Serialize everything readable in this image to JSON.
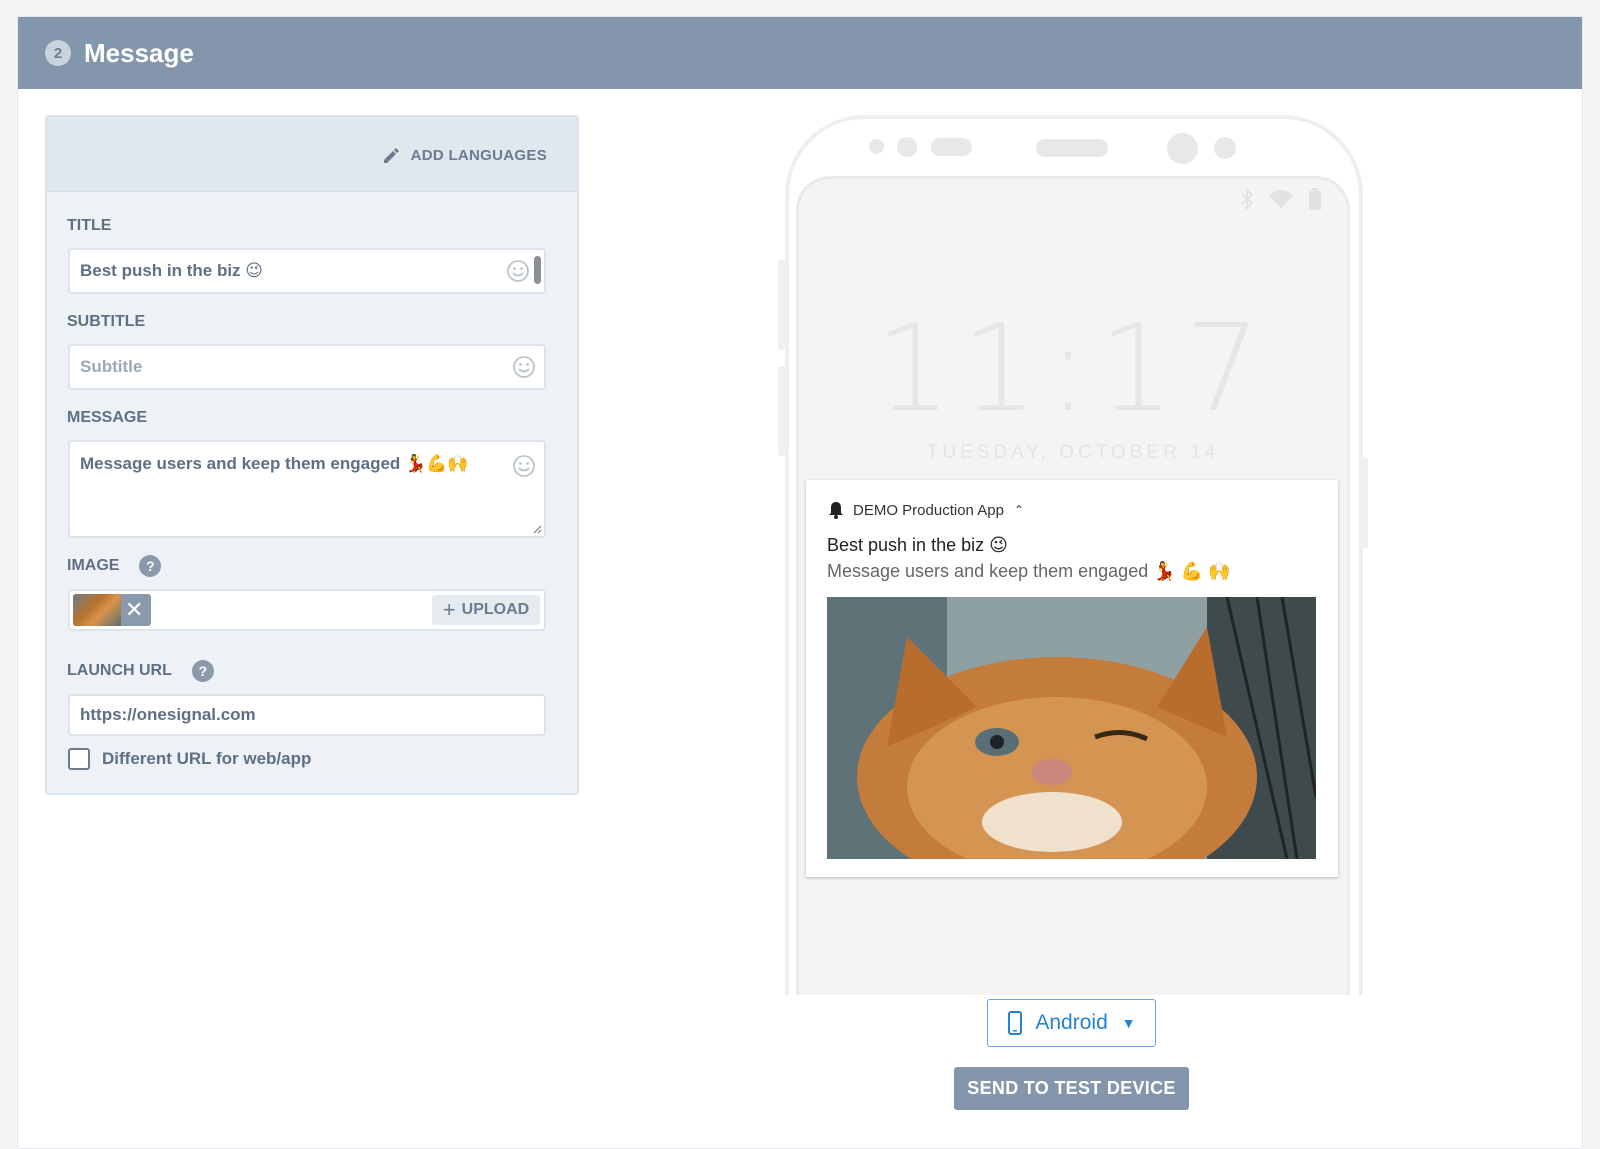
{
  "section": {
    "step": "2",
    "title": "Message"
  },
  "form": {
    "add_languages": "ADD LANGUAGES",
    "title": {
      "label": "TITLE",
      "value": "Best push in the biz 😉"
    },
    "subtitle": {
      "label": "SUBTITLE",
      "placeholder": "Subtitle"
    },
    "message": {
      "label": "MESSAGE",
      "value": "Message users and keep them engaged 💃💪🙌"
    },
    "image": {
      "label": "IMAGE",
      "help": "?",
      "upload": "UPLOAD",
      "remove": "✕"
    },
    "launch_url": {
      "label": "LAUNCH URL",
      "help": "?",
      "value": "https://onesignal.com"
    },
    "different_url": {
      "label": "Different URL for web/app",
      "checked": false
    }
  },
  "preview": {
    "clock": "11:17",
    "date": "TUESDAY, OCTOBER 14",
    "notification": {
      "app_name": "DEMO Production App",
      "title": "Best push in the biz 😉",
      "body": "Message users and keep them engaged 💃 💪 🙌"
    },
    "device": "Android",
    "send_test": "SEND TO TEST DEVICE"
  },
  "colors": {
    "header_bg": "#8496ab",
    "panel_bg": "#eef2f6",
    "accent_blue": "#2383d3",
    "button_bg": "#8496ab"
  }
}
